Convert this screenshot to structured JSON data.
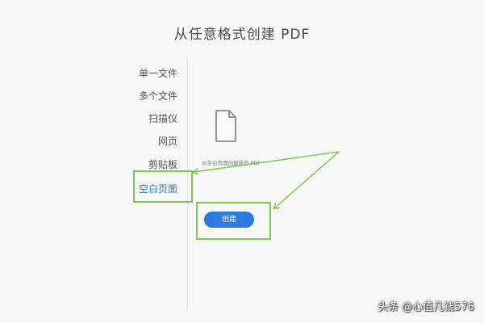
{
  "page": {
    "title": "从任意格式创建 PDF"
  },
  "sidebar": {
    "items": [
      {
        "label": "单一文件"
      },
      {
        "label": "多个文件"
      },
      {
        "label": "扫描仪"
      },
      {
        "label": "网页"
      },
      {
        "label": "剪贴板"
      },
      {
        "label": "空白页面",
        "active": true
      }
    ]
  },
  "main": {
    "icon": "document-icon",
    "description": "从空白页面创建新的 PDF",
    "create_button": "创建"
  },
  "annotations": {
    "highlight_color": "#7ccb50"
  },
  "watermark": "头条 @心值几钱576",
  "colors": {
    "accent": "#2d7be0",
    "highlight": "#7ccb50"
  }
}
